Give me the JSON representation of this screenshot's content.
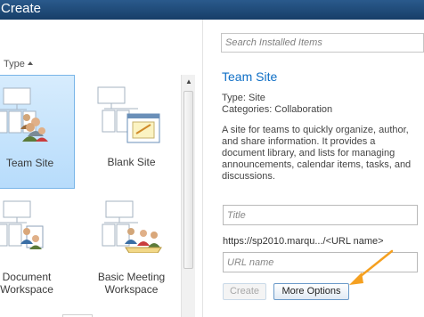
{
  "window": {
    "title": "Create"
  },
  "gallery": {
    "sort_label": "Type",
    "templates": [
      {
        "label": "Team Site",
        "selected": true
      },
      {
        "label": "Blank Site",
        "selected": false
      },
      {
        "label_line1": "Document",
        "label_line2": "Workspace"
      },
      {
        "label_line1": "Basic Meeting",
        "label_line2": "Workspace"
      }
    ]
  },
  "search": {
    "placeholder": "Search Installed Items"
  },
  "details": {
    "title": "Team Site",
    "type_line": "Type: Site",
    "categories_line": "Categories: Collaboration",
    "description": "A site for teams to quickly organize, author, and share information. It provides a document library, and lists for managing announcements, calendar items, tasks, and discussions."
  },
  "form": {
    "title_placeholder": "Title",
    "url_prefix": "https://sp2010.marqu.../<URL name>",
    "url_placeholder": "URL name",
    "create_label": "Create",
    "more_options_label": "More Options"
  },
  "colors": {
    "titlebar": "#1d4a79",
    "accent": "#0f6fc6",
    "selected_tile": "#c7e3fc",
    "annotation_arrow": "#f5a020"
  }
}
